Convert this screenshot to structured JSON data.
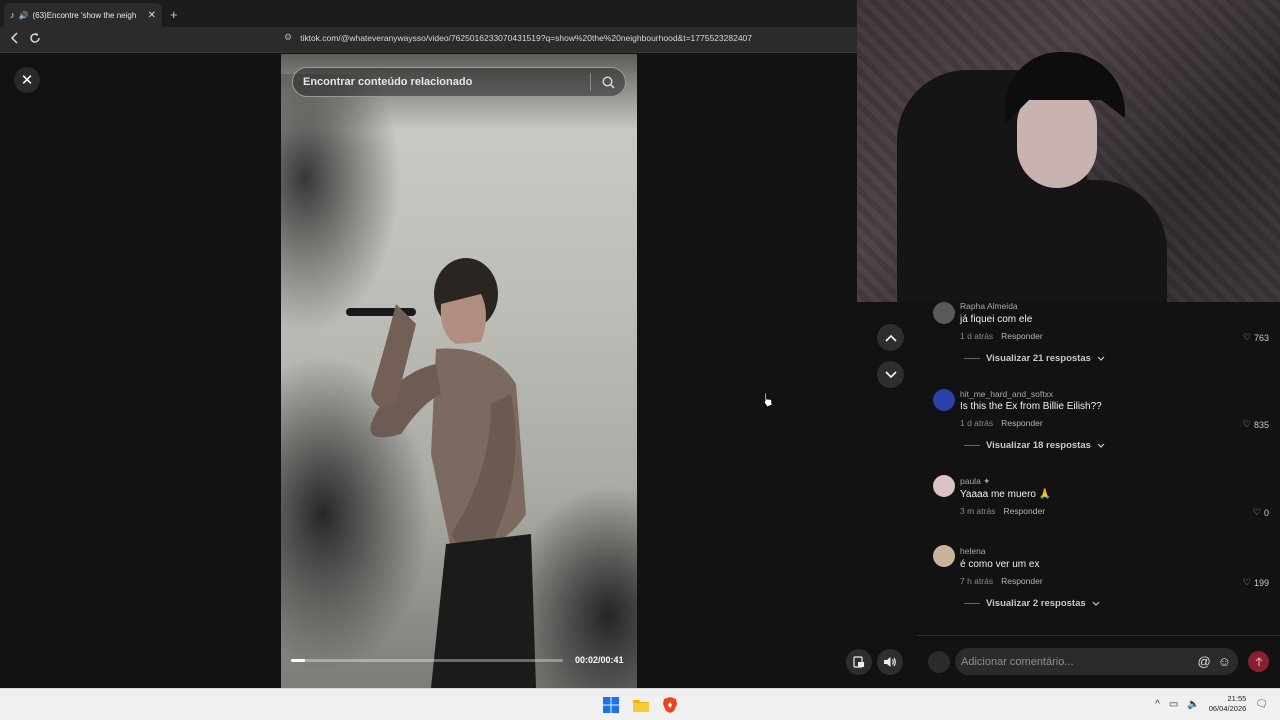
{
  "browser": {
    "tab_title": "(63)Encontre 'show the neigh",
    "tab_close": "✕",
    "new_tab": "+",
    "url": "tiktok.com/@whateveranywaysso/video/7625016233070431519?q=show%20the%20neighbourhood&t=1775523282407"
  },
  "player": {
    "close_symbol": "✕",
    "search_placeholder": "Encontrar conteúdo relacionado",
    "time": "00:02/00:41",
    "progress_fraction": 0.05
  },
  "comments": [
    {
      "user": "Rapha Almeida",
      "text": "já fiquei com ele",
      "age": "1 d atrás",
      "reply_label": "Responder",
      "likes": "763",
      "view_replies": "Visualizar 21 respostas",
      "avatar_color": "#5a5a5a"
    },
    {
      "user": "hit_me_hard_and_softxx",
      "text": "Is this the Ex from Billie Eilish??",
      "age": "1 d atrás",
      "reply_label": "Responder",
      "likes": "835",
      "view_replies": "Visualizar 18 respostas",
      "avatar_color": "#2a3fa8"
    },
    {
      "user": "paula ✦",
      "text": "Yaaaa me muero 🙏",
      "age": "3 m atrás",
      "reply_label": "Responder",
      "likes": "0",
      "view_replies": "",
      "avatar_color": "#d9c3c6"
    },
    {
      "user": "helena",
      "text": "é como ver um ex",
      "age": "7 h atrás",
      "reply_label": "Responder",
      "likes": "199",
      "view_replies": "Visualizar 2 respostas",
      "avatar_color": "#c9b49a"
    }
  ],
  "compose": {
    "placeholder": "Adicionar comentário...",
    "at_symbol": "@",
    "emoji_symbol": "☺"
  },
  "taskbar": {
    "time": "21:55",
    "date": "06/04/2026"
  }
}
